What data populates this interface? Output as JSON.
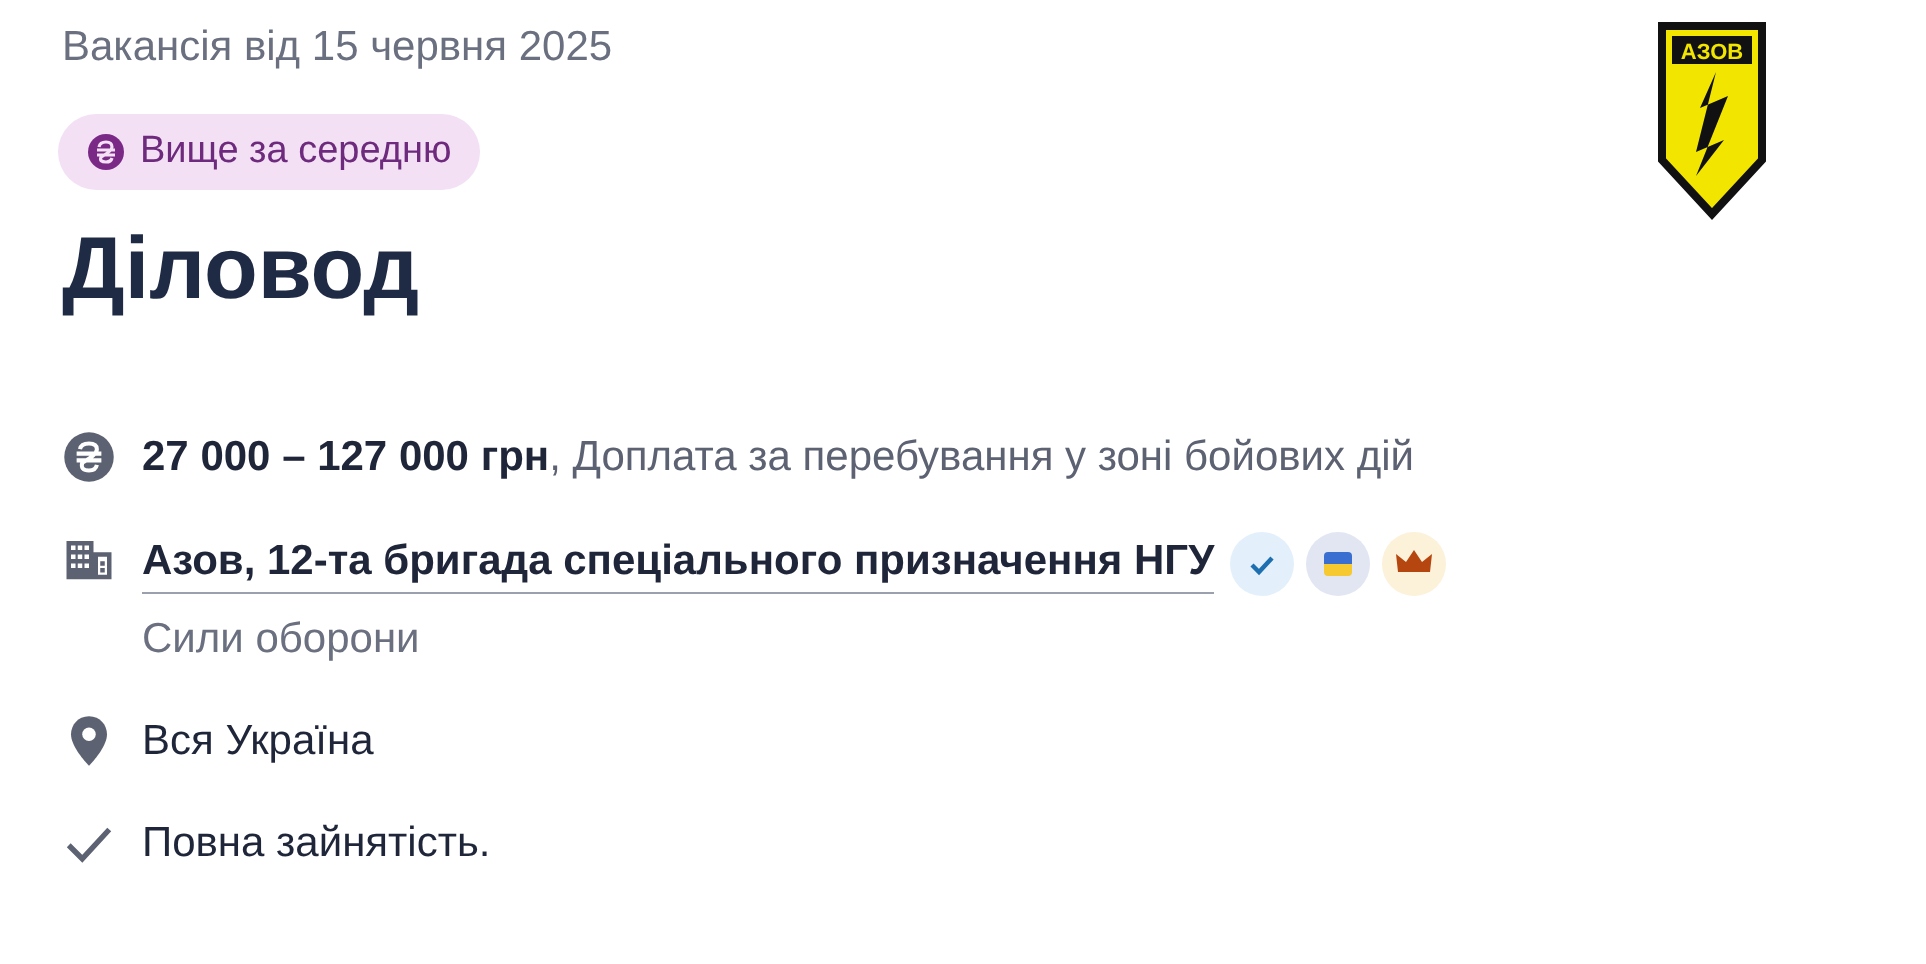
{
  "posted": "Вакансія від 15 червня 2025",
  "badge": {
    "label": "Вище за середню"
  },
  "logo": {
    "text": "АЗОВ"
  },
  "title": "Діловод",
  "details": [
    {
      "kind": "salary",
      "text": "**27 000 – 127 000 грн**, Доплата за перебування у зоні бойових дій"
    },
    {
      "kind": "company",
      "text": "Азов, 12-та бригада спеціального призначення НГУ",
      "subtitle": "Сили оборони",
      "badges": [
        {
          "kind": "verified"
        },
        {
          "kind": "ukraine"
        },
        {
          "kind": "premium"
        }
      ]
    },
    {
      "kind": "location",
      "text": "Вся Україна"
    },
    {
      "kind": "employment",
      "text": "Повна зайнятість."
    }
  ]
}
